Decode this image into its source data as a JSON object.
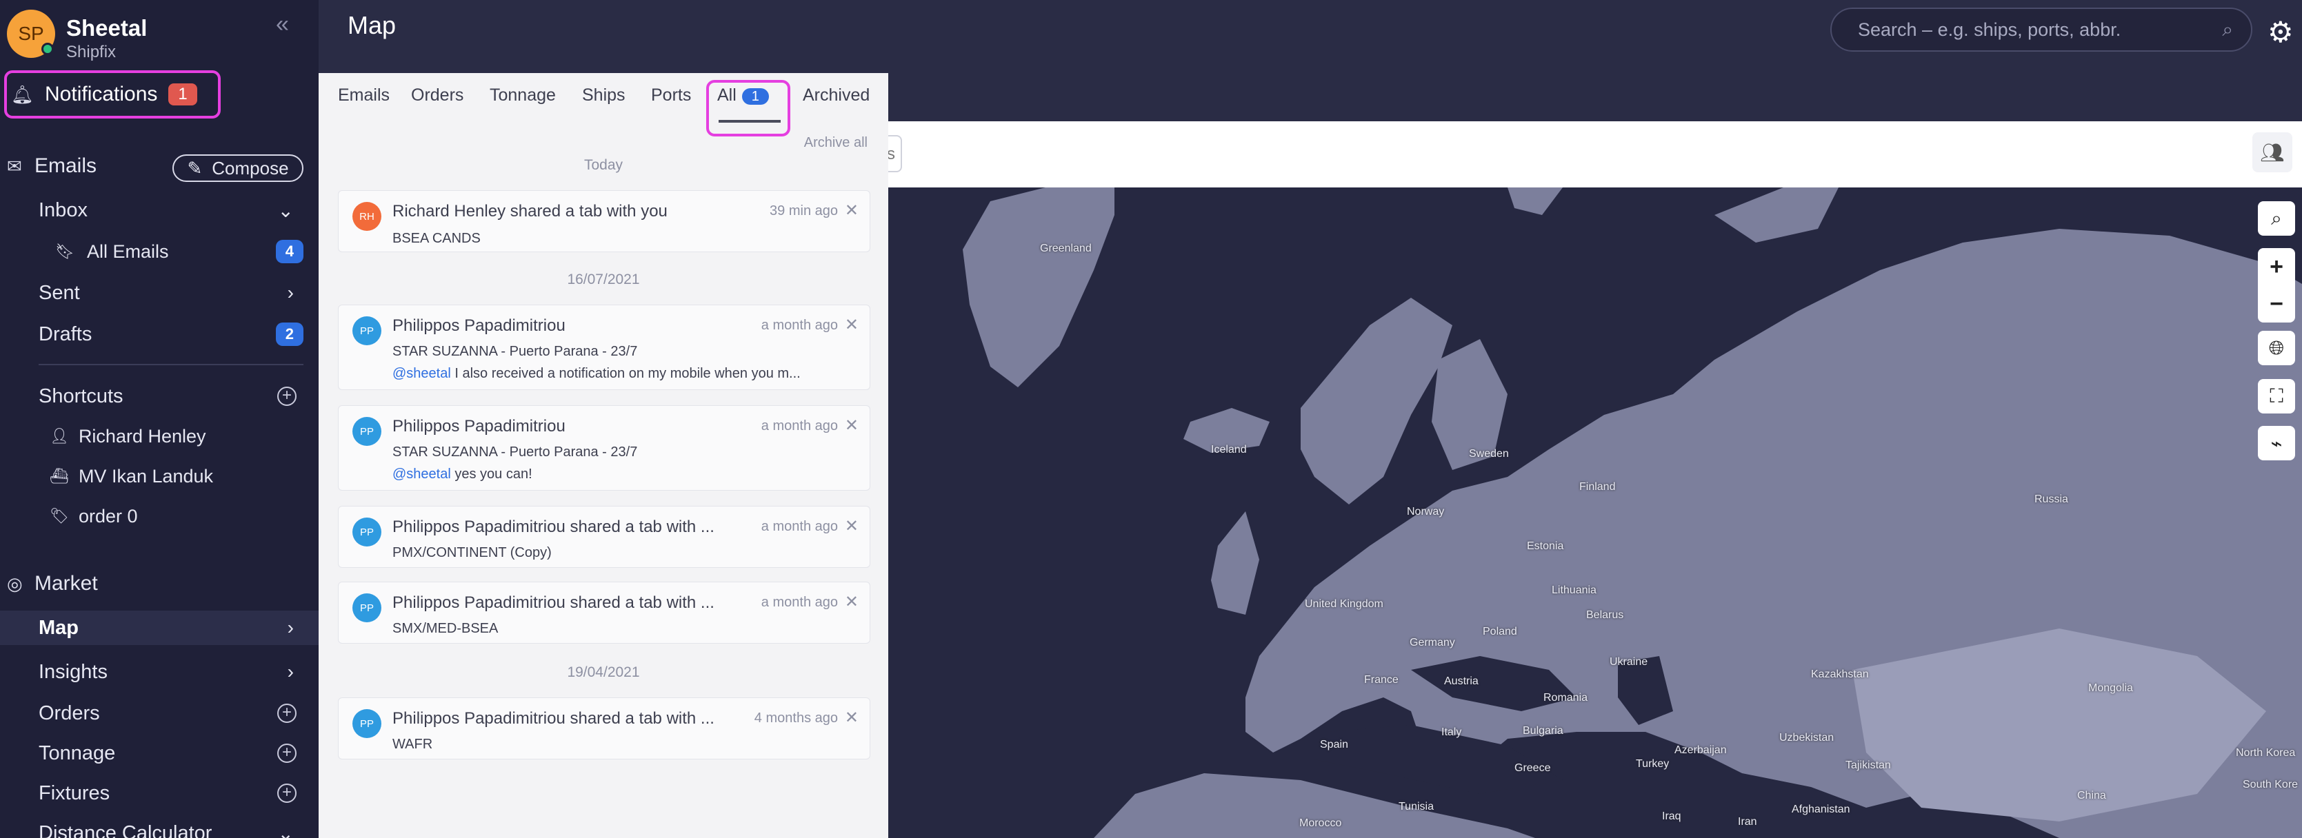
{
  "profile": {
    "initials": "SP",
    "name": "Sheetal",
    "org": "Shipfix"
  },
  "notifications_button": {
    "label": "Notifications",
    "count": "1"
  },
  "sidebar": {
    "emails_header": "Emails",
    "compose_label": "Compose",
    "inbox": "Inbox",
    "all_emails": "All Emails",
    "all_emails_count": "4",
    "sent": "Sent",
    "drafts": "Drafts",
    "drafts_count": "2",
    "shortcuts": "Shortcuts",
    "shortcut_items": [
      "Richard Henley",
      "MV Ikan Landuk",
      "order 0"
    ],
    "market_header": "Market",
    "market_items": [
      "Map",
      "Insights",
      "Orders",
      "Tonnage",
      "Fixtures",
      "Distance Calculator"
    ]
  },
  "header": {
    "title": "Map",
    "search_placeholder": "Search – e.g. ships, ports, abbr."
  },
  "panel": {
    "tabs": [
      "Emails",
      "Orders",
      "Tonnage",
      "Ships",
      "Ports",
      "All",
      "Archived"
    ],
    "all_count": "1",
    "archive_all": "Archive all",
    "groups": [
      {
        "date": "Today"
      },
      {
        "date": "16/07/2021"
      },
      {
        "date": "19/04/2021"
      }
    ],
    "cards": [
      {
        "initials": "RH",
        "color": "#f26b3a",
        "title": "Richard Henley shared a tab with you",
        "time": "39 min ago",
        "line1": "BSEA CANDS",
        "mention": "",
        "line2": ""
      },
      {
        "initials": "PP",
        "color": "#2f9be0",
        "title": "Philippos Papadimitriou",
        "time": "a month ago",
        "line1": "STAR SUZANNA - Puerto Parana - 23/7",
        "mention": "@sheetal",
        "line2": " I also received a notification on my mobile when you m..."
      },
      {
        "initials": "PP",
        "color": "#2f9be0",
        "title": "Philippos Papadimitriou",
        "time": "a month ago",
        "line1": "STAR SUZANNA - Puerto Parana - 23/7",
        "mention": "@sheetal",
        "line2": " yes you can!"
      },
      {
        "initials": "PP",
        "color": "#2f9be0",
        "title": "Philippos Papadimitriou shared a tab with ...",
        "time": "a month ago",
        "line1": "PMX/CONTINENT (Copy)",
        "mention": "",
        "line2": ""
      },
      {
        "initials": "PP",
        "color": "#2f9be0",
        "title": "Philippos Papadimitriou shared a tab with ...",
        "time": "a month ago",
        "line1": "SMX/MED-BSEA",
        "mention": "",
        "line2": ""
      },
      {
        "initials": "PP",
        "color": "#2f9be0",
        "title": "Philippos Papadimitriou shared a tab with ...",
        "time": "4 months ago",
        "line1": "WAFR",
        "mention": "",
        "line2": ""
      }
    ]
  },
  "toolbar": {
    "ghost_text": "s"
  },
  "map": {
    "labels": [
      "Greenland",
      "Iceland",
      "Sweden",
      "Finland",
      "Norway",
      "Estonia",
      "Russia",
      "Lithuania",
      "United Kingdom",
      "Belarus",
      "Poland",
      "Germany",
      "Ukraine",
      "France",
      "Austria",
      "Romania",
      "Kazakhstan",
      "Mongolia",
      "Italy",
      "Bulgaria",
      "Spain",
      "Greece",
      "Turkey",
      "Azerbaijan",
      "Uzbekistan",
      "Tajikistan",
      "North Korea",
      "South Kore",
      "Tunisia",
      "Iraq",
      "Iran",
      "Afghanistan",
      "China",
      "Morocco"
    ]
  }
}
